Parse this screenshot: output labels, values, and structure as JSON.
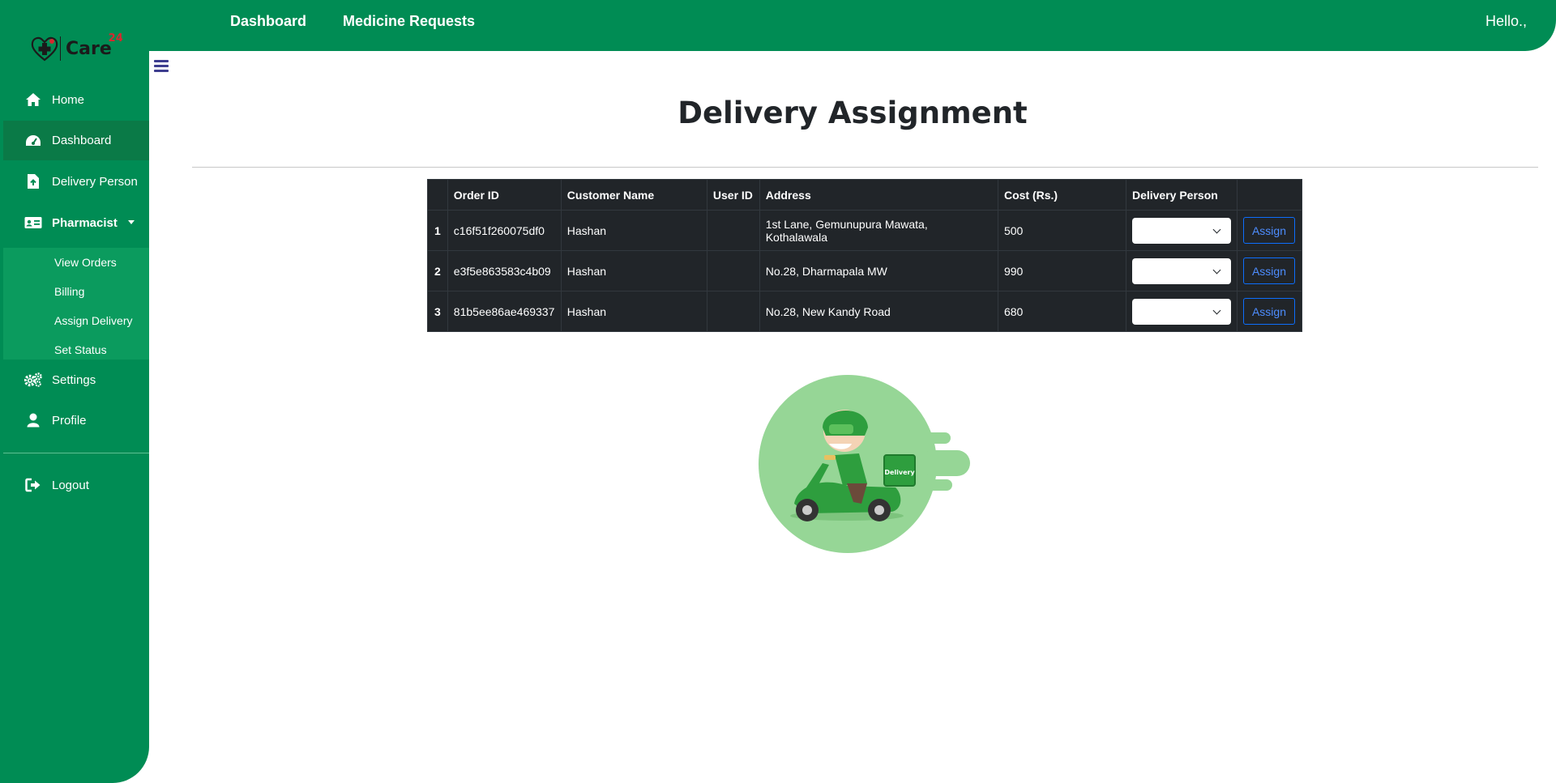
{
  "brand": {
    "logo_text": "Care",
    "logo_sup": "24"
  },
  "sidebar": {
    "items": [
      {
        "label": "Home",
        "icon": "home-icon"
      },
      {
        "label": "Dashboard",
        "icon": "dashboard-gauge-icon"
      },
      {
        "label": "Delivery Person",
        "icon": "file-upload-icon"
      },
      {
        "label": "Pharmacist",
        "icon": "id-card-icon"
      },
      {
        "label": "Settings",
        "icon": "gears-icon"
      },
      {
        "label": "Profile",
        "icon": "user-icon"
      },
      {
        "label": "Logout",
        "icon": "sign-out-icon"
      }
    ],
    "submenu": [
      "View Orders",
      "Billing",
      "Assign Delivery",
      "Set Status"
    ]
  },
  "topbar": {
    "links": [
      "Dashboard",
      "Medicine Requests"
    ],
    "greeting": "Hello.,"
  },
  "page": {
    "title": "Delivery Assignment"
  },
  "table": {
    "headers": [
      "",
      "Order ID",
      "Customer Name",
      "User ID",
      "Address",
      "Cost (Rs.)",
      "Delivery Person",
      ""
    ],
    "rows": [
      {
        "num": "1",
        "order_id": "c16f51f260075df0",
        "customer": "Hashan",
        "user_id": "",
        "address": "1st Lane, Gemunupura Mawata, Kothalawala",
        "cost": "500",
        "delivery_person": "",
        "action": "Assign"
      },
      {
        "num": "2",
        "order_id": "e3f5e863583c4b09",
        "customer": "Hashan",
        "user_id": "",
        "address": "No.28, Dharmapala MW",
        "cost": "990",
        "delivery_person": "",
        "action": "Assign"
      },
      {
        "num": "3",
        "order_id": "81b5ee86ae469337",
        "customer": "Hashan",
        "user_id": "",
        "address": "No.28, New Kandy Road",
        "cost": "680",
        "delivery_person": "",
        "action": "Assign"
      }
    ]
  },
  "illustration": {
    "box_label": "Delivery"
  },
  "colors": {
    "primary": "#008c54",
    "active": "#0a7a47",
    "submenu": "#0b9b5e",
    "table_bg": "#212529",
    "accent": "#0d6efd"
  }
}
